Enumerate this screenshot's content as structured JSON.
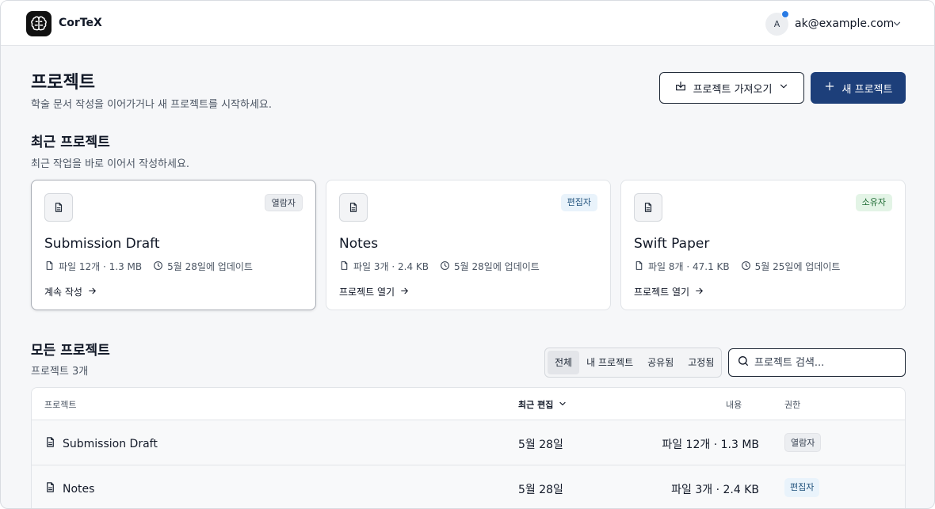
{
  "app": {
    "brand": "CorTeX"
  },
  "user": {
    "avatar_initial": "A",
    "email": "ak@example.com"
  },
  "page": {
    "title": "프로젝트",
    "subtitle": "학술 문서 작성을 이어가거나 새 프로젝트를 시작하세요.",
    "import_label": "프로젝트 가져오기",
    "new_label": "새 프로젝트"
  },
  "recent": {
    "title": "최근 프로젝트",
    "subtitle": "최근 작업을 바로 이어서 작성하세요.",
    "cards": [
      {
        "title": "Submission Draft",
        "role": "열람자",
        "files": "파일 12개 · 1.3 MB",
        "updated": "5월 28일에 업데이트",
        "action": "계속 작성"
      },
      {
        "title": "Notes",
        "role": "편집자",
        "files": "파일 3개 · 2.4 KB",
        "updated": "5월 28일에 업데이트",
        "action": "프로젝트 열기"
      },
      {
        "title": "Swift Paper",
        "role": "소유자",
        "files": "파일 8개 · 47.1 KB",
        "updated": "5월 25일에 업데이트",
        "action": "프로젝트 열기"
      }
    ]
  },
  "all": {
    "title": "모든 프로젝트",
    "count": "프로젝트 3개",
    "filters": [
      "전체",
      "내 프로젝트",
      "공유됨",
      "고정됨"
    ],
    "active_filter": "전체",
    "search_placeholder": "프로젝트 검색...",
    "columns": {
      "project": "프로젝트",
      "edited": "최근 편집",
      "content": "내용",
      "role": "권한"
    },
    "rows": [
      {
        "name": "Submission Draft",
        "date": "5월 28일",
        "content": "파일 12개 · 1.3 MB",
        "role": "열람자"
      },
      {
        "name": "Notes",
        "date": "5월 28일",
        "content": "파일 3개 · 2.4 KB",
        "role": "편집자"
      }
    ]
  },
  "colors": {
    "primary": "#1d3f7a",
    "notification": "#2a7be4",
    "editor_badge": "#e9f3fb",
    "owner_badge": "#e3f4e6"
  },
  "icons": [
    "brain-logo-icon",
    "chevron-down-icon",
    "import-icon",
    "plus-icon",
    "document-icon",
    "file-icon",
    "clock-icon",
    "arrow-right-icon",
    "search-icon"
  ]
}
